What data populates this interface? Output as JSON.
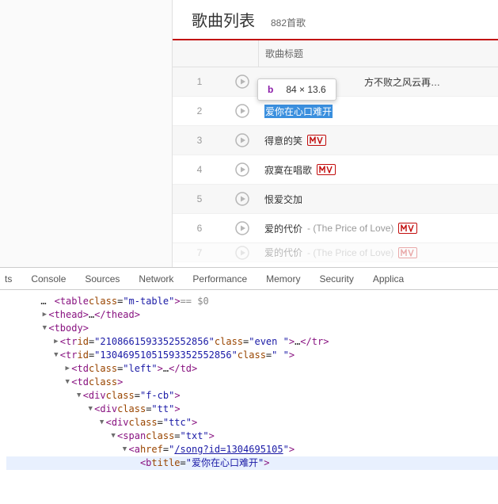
{
  "header": {
    "title": "歌曲列表",
    "count": "882首歌"
  },
  "table_header": "歌曲标题",
  "tooltip": {
    "tag": "b",
    "dim": "84 × 13.6"
  },
  "songs": [
    {
      "idx": "1",
      "title": "方不败之风云再…",
      "sub": "",
      "mv": false,
      "selected": false,
      "overlaid": true
    },
    {
      "idx": "2",
      "title": "爱你在心口难开",
      "sub": "",
      "mv": false,
      "selected": true
    },
    {
      "idx": "3",
      "title": "得意的笑",
      "sub": "",
      "mv": true,
      "selected": false
    },
    {
      "idx": "4",
      "title": "寂寞在唱歌",
      "sub": "",
      "mv": true,
      "selected": false
    },
    {
      "idx": "5",
      "title": "恨爱交加",
      "sub": "",
      "mv": false,
      "selected": false
    },
    {
      "idx": "6",
      "title": "爱的代价",
      "sub": " - (The Price of Love)",
      "mv": true,
      "selected": false
    },
    {
      "idx": "7",
      "title": "爱的代价",
      "sub": " - (The Price of Love)",
      "mv": true,
      "selected": false,
      "faded": true
    }
  ],
  "devtools": {
    "tabs": [
      "ts",
      "Console",
      "Sources",
      "Network",
      "Performance",
      "Memory",
      "Security",
      "Applica"
    ],
    "lines": [
      {
        "indent": 6,
        "arrow": "",
        "html": "<span class='p-tag'>&lt;table</span> <span class='p-attr'>class</span>=<span class='p-val'>\"m-table\"</span><span class='p-tag'>&gt;</span> <span class='p-gray'>== $0</span>",
        "pre": "…"
      },
      {
        "indent": 6,
        "arrow": "▶",
        "html": "<span class='p-tag'>&lt;thead&gt;</span>…<span class='p-tag'>&lt;/thead&gt;</span>"
      },
      {
        "indent": 6,
        "arrow": "▼",
        "html": "<span class='p-tag'>&lt;tbody&gt;</span>"
      },
      {
        "indent": 8,
        "arrow": "▶",
        "html": "<span class='p-tag'>&lt;tr</span> <span class='p-attr'>id</span>=<span class='p-val'>\"2108661593352552856\"</span> <span class='p-attr'>class</span>=<span class='p-val'>\"even \"</span><span class='p-tag'>&gt;</span>…<span class='p-tag'>&lt;/tr&gt;</span>"
      },
      {
        "indent": 8,
        "arrow": "▼",
        "html": "<span class='p-tag'>&lt;tr</span> <span class='p-attr'>id</span>=<span class='p-val'>\"13046951051593352552856\"</span> <span class='p-attr'>class</span>=<span class='p-val'>\" \"</span><span class='p-tag'>&gt;</span>"
      },
      {
        "indent": 10,
        "arrow": "▶",
        "html": "<span class='p-tag'>&lt;td</span> <span class='p-attr'>class</span>=<span class='p-val'>\"left\"</span><span class='p-tag'>&gt;</span>…<span class='p-tag'>&lt;/td&gt;</span>"
      },
      {
        "indent": 10,
        "arrow": "▼",
        "html": "<span class='p-tag'>&lt;td</span> <span class='p-attr'>class</span><span class='p-tag'>&gt;</span>"
      },
      {
        "indent": 12,
        "arrow": "▼",
        "html": "<span class='p-tag'>&lt;div</span> <span class='p-attr'>class</span>=<span class='p-val'>\"f-cb\"</span><span class='p-tag'>&gt;</span>"
      },
      {
        "indent": 14,
        "arrow": "▼",
        "html": "<span class='p-tag'>&lt;div</span> <span class='p-attr'>class</span>=<span class='p-val'>\"tt\"</span><span class='p-tag'>&gt;</span>"
      },
      {
        "indent": 16,
        "arrow": "▼",
        "html": "<span class='p-tag'>&lt;div</span> <span class='p-attr'>class</span>=<span class='p-val'>\"ttc\"</span><span class='p-tag'>&gt;</span>"
      },
      {
        "indent": 18,
        "arrow": "▼",
        "html": "<span class='p-tag'>&lt;span</span> <span class='p-attr'>class</span>=<span class='p-val'>\"txt\"</span><span class='p-tag'>&gt;</span>"
      },
      {
        "indent": 20,
        "arrow": "▼",
        "html": "<span class='p-tag'>&lt;a</span> <span class='p-attr'>href</span>=<span class='p-val'>\"<span class='p-link'>/song?id=1304695105</span>\"</span><span class='p-tag'>&gt;</span>"
      },
      {
        "indent": 22,
        "arrow": "",
        "html": "<span class='p-tag'>&lt;b</span> <span class='p-attr'>title</span>=<span class='p-val'>\"爱你在心口难开\"</span><span class='p-tag'>&gt;</span>",
        "hl": true
      }
    ]
  }
}
